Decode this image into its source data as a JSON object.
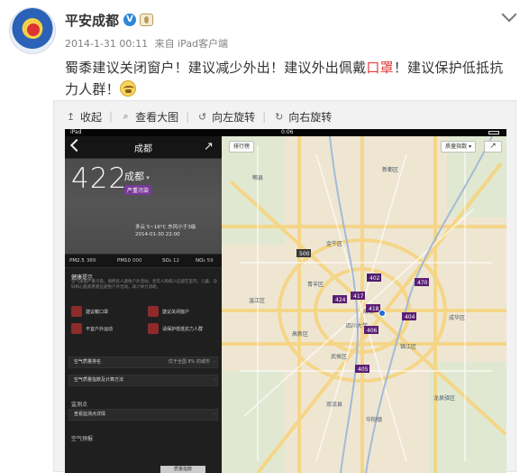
{
  "post": {
    "author": "平安成都",
    "verified": "V",
    "time": "2014-1-31 00:11",
    "source_prefix": "来自",
    "source": "iPad客户端",
    "text": {
      "part1": "蜀黍建议关闭窗户！建议减少外出！建议外出佩戴",
      "highlight": "口罩",
      "part2": "！建议保护低抵抗力人群！"
    }
  },
  "actions": {
    "collapse": "收起",
    "view_large": "查看大图",
    "rotate_left": "向左旋转",
    "rotate_right": "向右旋转"
  },
  "screenshot": {
    "status": {
      "device": "iPad",
      "time": "0:06"
    },
    "left": {
      "city": "成都",
      "aqi": "422",
      "aqi_city": "成都",
      "badge": "严重污染",
      "weather": "多云 5~16°C 东风小于3级\n2014-01-30 22:00",
      "pollutants": [
        {
          "name": "PM2.5",
          "value": "389"
        },
        {
          "name": "PM10",
          "value": "000"
        },
        {
          "name": "SO₂",
          "value": "12"
        },
        {
          "name": "NO₂",
          "value": "59"
        }
      ],
      "advice_title": "健康提示",
      "advice_desc": "空气质量严重污染。请所有人避免户外活动，老年人和病人应留在室内，儿童、孕妇和心脏病患者应避免户外活动，减少体力消耗。",
      "advice_items": [
        {
          "label": "建议戴口罩",
          "icon": "mask-icon"
        },
        {
          "label": "建议关闭窗户",
          "icon": "window-icon"
        },
        {
          "label": "不宜户外运动",
          "icon": "runner-icon"
        },
        {
          "label": "请保护低抵抗力人群",
          "icon": "people-icon"
        }
      ],
      "ranking_label": "空气质量排名",
      "ranking_value": "优于全国 8% 的城市",
      "method_label": "空气质量指数及计算方法",
      "monitoring_title": "监测点",
      "monitoring_label": "查看监测点详情",
      "bottom_section": "空气预报",
      "bottom_btn": "质量指数"
    },
    "map": {
      "rank_button": "排行榜",
      "index_button": "质量指数",
      "labels": [
        "新都区",
        "郫县",
        "青羊区",
        "武侯区",
        "双流县",
        "锦江区",
        "成华区",
        "龙泉驿区",
        "温江区",
        "华阳镇",
        "成都",
        "四川大学",
        "金牛区",
        "高新区"
      ],
      "markers": [
        {
          "value": "500",
          "color": "#3a3a3a"
        },
        {
          "value": "402",
          "color": "#4d1d6b"
        },
        {
          "value": "424",
          "color": "#5a1e74"
        },
        {
          "value": "417",
          "color": "#5a1e74"
        },
        {
          "value": "418",
          "color": "#5a1e74"
        },
        {
          "value": "470",
          "color": "#5a1e74"
        },
        {
          "value": "404",
          "color": "#5a1e74"
        },
        {
          "value": "406",
          "color": "#5a1e74"
        },
        {
          "value": "405",
          "color": "#5a1e74"
        }
      ]
    }
  }
}
